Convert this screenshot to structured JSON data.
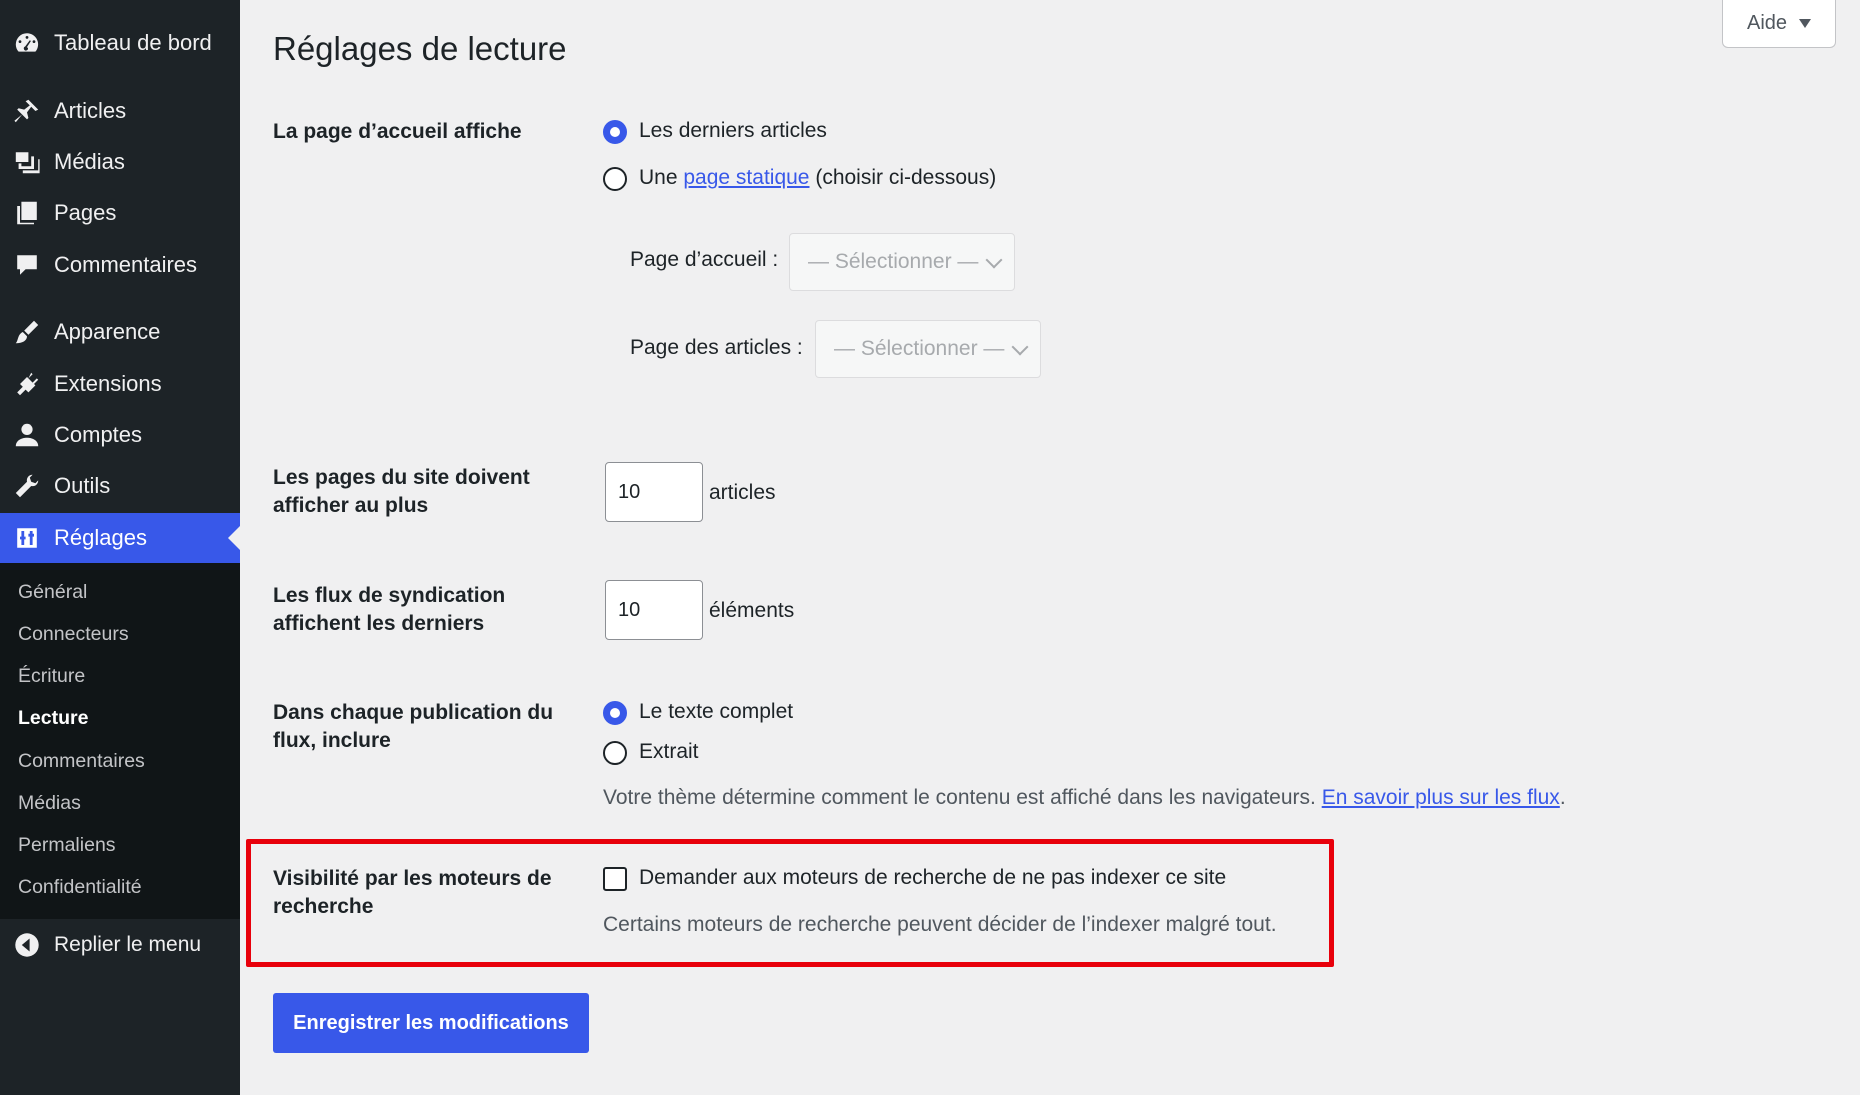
{
  "sidebar": {
    "items": [
      {
        "label": "Tableau de bord",
        "icon": "dashboard-icon"
      },
      {
        "label": "Articles",
        "icon": "pin-icon"
      },
      {
        "label": "Médias",
        "icon": "media-icon"
      },
      {
        "label": "Pages",
        "icon": "pages-icon"
      },
      {
        "label": "Commentaires",
        "icon": "comment-icon"
      },
      {
        "label": "Apparence",
        "icon": "brush-icon"
      },
      {
        "label": "Extensions",
        "icon": "plugin-icon"
      },
      {
        "label": "Comptes",
        "icon": "user-icon"
      },
      {
        "label": "Outils",
        "icon": "wrench-icon"
      },
      {
        "label": "Réglages",
        "icon": "settings-icon"
      }
    ],
    "submenu": [
      "Général",
      "Connecteurs",
      "Écriture",
      "Lecture",
      "Commentaires",
      "Médias",
      "Permaliens",
      "Confidentialité"
    ],
    "current_submenu": "Lecture",
    "collapse_label": "Replier le menu"
  },
  "header": {
    "help_label": "Aide",
    "title": "Réglages de lecture"
  },
  "form": {
    "homepage": {
      "label": "La page d’accueil affiche",
      "option_latest": "Les derniers articles",
      "option_static_prefix": "Une",
      "option_static_link": "page statique",
      "option_static_suffix": "(choisir ci-dessous)",
      "selected": "latest",
      "front_page_label": "Page d’accueil :",
      "front_page_value": "— Sélectionner —",
      "posts_page_label": "Page des articles :",
      "posts_page_value": "— Sélectionner —"
    },
    "posts_per_page": {
      "label_line1": "Les pages du site doivent",
      "label_line2": "afficher au plus",
      "value": "10",
      "unit": "articles"
    },
    "feed_items": {
      "label_line1": "Les flux de syndication",
      "label_line2": "affichent les derniers",
      "value": "10",
      "unit": "éléments"
    },
    "feed_content": {
      "label_line1": "Dans chaque publication du",
      "label_line2": "flux, inclure",
      "option_full": "Le texte complet",
      "option_excerpt": "Extrait",
      "selected": "full",
      "description": "Votre thème détermine comment le contenu est affiché dans les navigateurs.",
      "description_link": "En savoir plus sur les flux",
      "description_end": "."
    },
    "search_visibility": {
      "label_line1": "Visibilité par les moteurs de",
      "label_line2": "recherche",
      "checkbox_label": "Demander aux moteurs de recherche de ne pas indexer ce site",
      "checked": false,
      "description": "Certains moteurs de recherche peuvent décider de l’indexer malgré tout."
    },
    "save_label": "Enregistrer les modifications"
  },
  "colors": {
    "accent": "#3858e9",
    "sidebar_bg": "#1d2327",
    "highlight": "#e8000b"
  }
}
